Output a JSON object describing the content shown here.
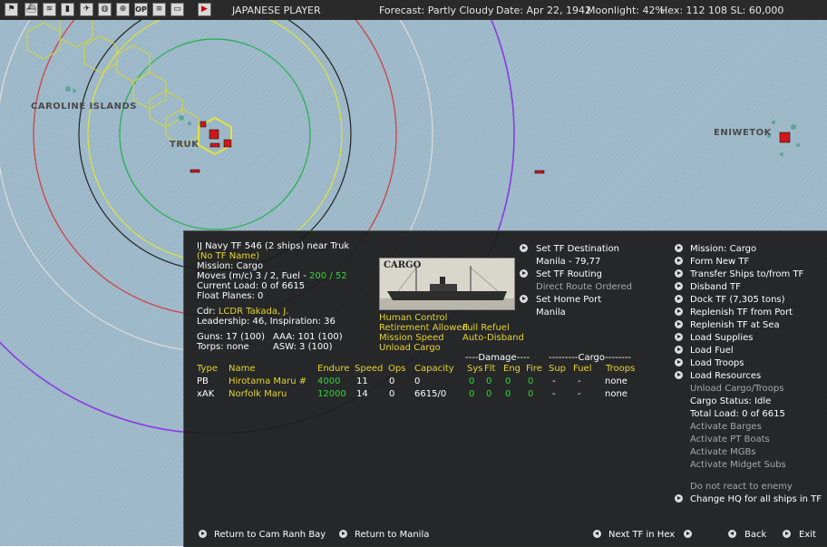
{
  "topbar": {
    "icons": [
      {
        "name": "flag-icon",
        "glyph": "⚑"
      },
      {
        "name": "ship-icon",
        "glyph": "⛴"
      },
      {
        "name": "wave-icon",
        "glyph": "≋"
      },
      {
        "name": "chart-icon",
        "glyph": "▮"
      },
      {
        "name": "plane-icon",
        "glyph": "✈"
      },
      {
        "name": "globe-icon",
        "glyph": "◍"
      },
      {
        "name": "target-icon",
        "glyph": "⊕"
      },
      {
        "name": "ops-icon",
        "glyph": "OP"
      },
      {
        "name": "list-icon",
        "glyph": "≡"
      },
      {
        "name": "window-icon",
        "glyph": "▭"
      },
      {
        "name": "play-icon",
        "glyph": "▶"
      }
    ],
    "player": "JAPANESE PLAYER",
    "forecast": "Forecast: Partly Cloudy",
    "date": "Date: Apr 22, 1942",
    "moonlight": "Moonlight: 42%",
    "hex": "Hex: 112 108  SL: 60,000"
  },
  "map_labels": {
    "caroline": "CAROLINE ISLANDS",
    "truk": "TRUK",
    "eniwetok": "ENIWETOK"
  },
  "tf": {
    "header": "IJ Navy TF 546 (2 ships) near Truk",
    "name_note": "(No TF Name)",
    "mission": "Mission: Cargo",
    "moves_prefix": "Moves (m/c) 3 / 2, Fuel - ",
    "fuel": "200 / 52",
    "current_load": "Current Load:  0 of 6615",
    "float_planes": "Float Planes:  0",
    "cdr_prefix": "Cdr: ",
    "cdr": "LCDR Takada, J.",
    "leadership": "Leadership: 46, Inspiration: 36",
    "guns": "Guns: 17 (100)",
    "aaa": "AAA: 101 (100)",
    "torps": "Torps: none",
    "asw": "ASW: 3 (100)",
    "photo_caption": "CARGO",
    "flags": {
      "human_control": "Human Control",
      "retirement": "Retirement Allowed",
      "full_refuel": "Full Refuel",
      "mission_speed": "Mission Speed",
      "auto_disband": "Auto-Disband",
      "unload_cargo": "Unload Cargo"
    }
  },
  "routing": {
    "set_destination": "Set TF Destination",
    "destination": "Manila - 79,77",
    "set_routing": "Set TF Routing",
    "direct_route": "Direct Route Ordered",
    "set_home": "Set Home Port",
    "home": "Manila"
  },
  "table": {
    "damage_header": "----Damage----",
    "cargo_header": "---------Cargo--------",
    "headers": [
      "Type",
      "Name",
      "Endure",
      "Speed",
      "Ops",
      "Capacity",
      "Sys",
      "Flt",
      "Eng",
      "Fire",
      "Sup",
      "Fuel",
      "Troops"
    ],
    "rows": [
      {
        "type": "PB",
        "name": "Hirotama Maru #",
        "endure": "4000",
        "speed": "11",
        "ops": "0",
        "capacity": "0",
        "sys": "0",
        "flt": "0",
        "eng": "0",
        "fire": "0",
        "sup": "-",
        "fuel": "-",
        "troops": "none"
      },
      {
        "type": "xAK",
        "name": "Norfolk Maru",
        "endure": "12000",
        "speed": "14",
        "ops": "0",
        "capacity": "6615/0",
        "sys": "0",
        "flt": "0",
        "eng": "0",
        "fire": "0",
        "sup": "-",
        "fuel": "-",
        "troops": "none"
      }
    ]
  },
  "actions": {
    "mission_cargo": "Mission: Cargo",
    "form_new": "Form New TF",
    "transfer": "Transfer Ships to/from TF",
    "disband": "Disband TF",
    "dock": "Dock TF (7,305 tons)",
    "replenish_port": "Replenish TF from Port",
    "replenish_sea": "Replenish TF at Sea",
    "load_supplies": "Load Supplies",
    "load_fuel": "Load Fuel",
    "load_troops": "Load Troops",
    "load_resources": "Load Resources",
    "unload": "Unload Cargo/Troops",
    "cargo_status": "Cargo Status: Idle",
    "total_load": "Total Load: 0 of 6615",
    "barges": "Activate Barges",
    "pt_boats": "Activate PT Boats",
    "mgbs": "Activate MGBs",
    "midget_subs": "Activate Midget Subs",
    "no_react": "Do not react to enemy",
    "change_hq": "Change HQ for all ships in TF"
  },
  "footer": {
    "return_cam": "Return to Cam Ranh Bay",
    "return_manila": "Return to Manila",
    "next_tf": "Next TF in Hex",
    "back": "Back",
    "exit": "Exit"
  },
  "colors": {
    "highlight_yellow": "#e7d42d",
    "highlight_green": "#34d43a",
    "disabled_gray": "#a8a8a8",
    "sea": "#9bb7c8"
  }
}
